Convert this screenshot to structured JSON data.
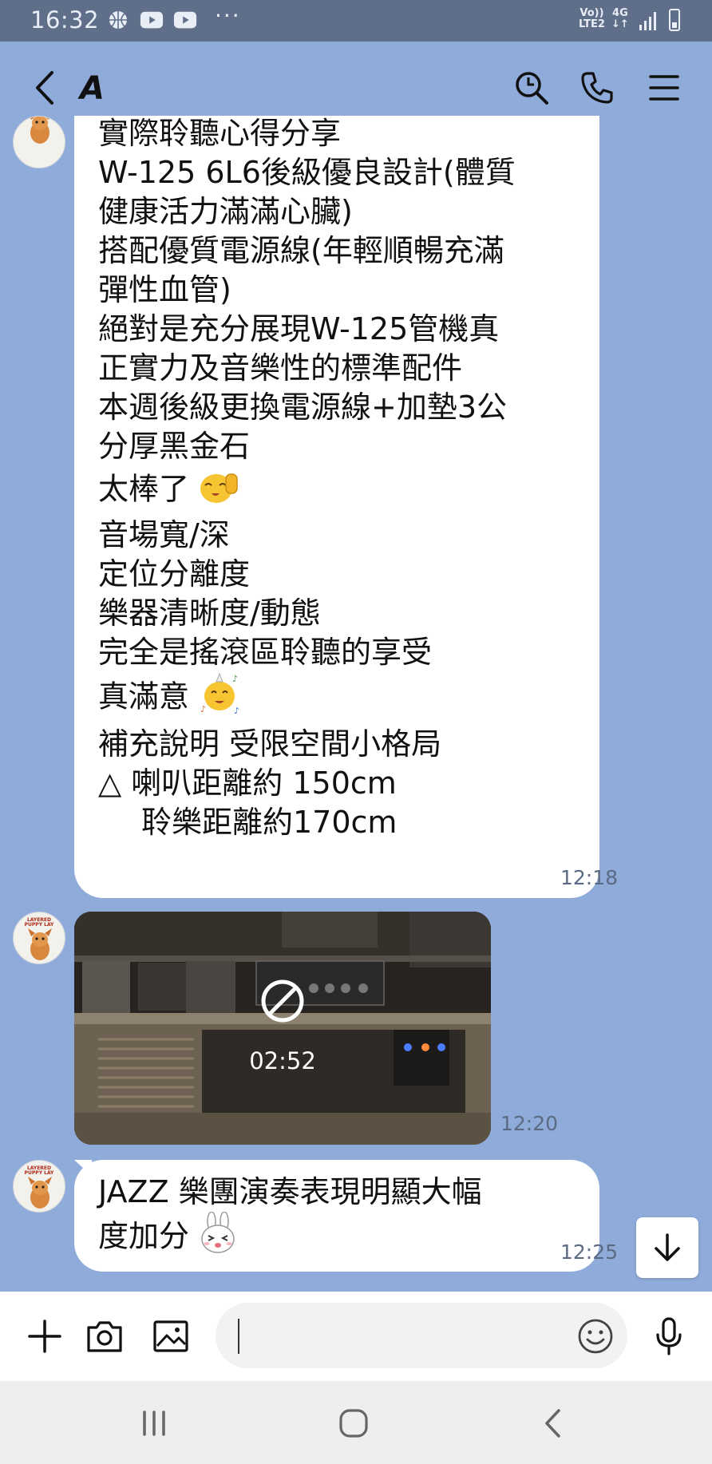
{
  "status_bar": {
    "time": "16:32",
    "dots": "···",
    "volte": "Vo))",
    "lte": "LTE2",
    "network": "4G",
    "network_arrows": "↓↑"
  },
  "header": {
    "title": "A"
  },
  "messages": [
    {
      "lines": [
        "實際聆聽心得分享",
        "W-125 6L6後級優良設計(體質",
        "健康活力滿滿心臟)",
        "搭配優質電源線(年輕順暢充滿",
        "彈性血管)",
        "絕對是充分展現W-125管機真",
        "正實力及音樂性的標準配件",
        "本週後級更換電源線+加墊3公",
        "分厚黑金石",
        "太棒了",
        "音場寬/深",
        "定位分離度",
        "樂器清晰度/動態",
        "完全是搖滾區聆聽的享受",
        "真滿意",
        "補充說明 受限空間小格局",
        "△ 喇叭距離約 150cm",
        "聆樂距離約170cm"
      ],
      "time": "12:18"
    },
    {
      "video_duration": "02:52",
      "time": "12:20"
    },
    {
      "lines": [
        "JAZZ 樂團演奏表現明顯大幅",
        "度加分"
      ],
      "time": "12:25"
    }
  ],
  "avatar": {
    "text_line1": "LAYERED",
    "text_line2": "PUPPY LAY"
  },
  "colors": {
    "chat_background": "#8fabd9",
    "status_bar": "#5f6f8a",
    "bubble": "#ffffff",
    "time_text": "#5c6b84"
  },
  "icons": [
    "back-icon",
    "search-icon",
    "call-icon",
    "menu-icon",
    "plus-icon",
    "camera-icon",
    "image-icon",
    "emoji-icon",
    "mic-icon",
    "scroll-down-icon"
  ],
  "input": {
    "value": "",
    "placeholder": ""
  }
}
